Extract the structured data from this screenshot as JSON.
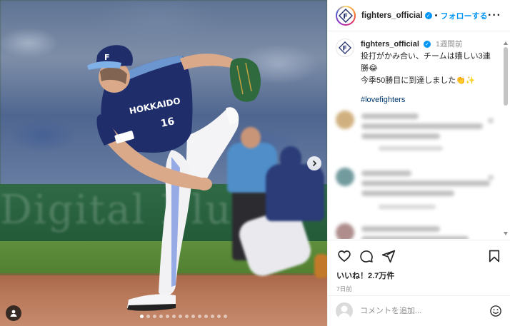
{
  "photo": {
    "alt": "",
    "banner_text": "Digital Blue",
    "jersey": {
      "team": "HOKKAIDO",
      "number": "16",
      "cap_letter": "F"
    },
    "pager": {
      "count": 14,
      "active_index": 0
    }
  },
  "header": {
    "username": "fighters_official",
    "separator": "•",
    "follow_label": "フォローする",
    "more_label": "···"
  },
  "caption": {
    "username": "fighters_official",
    "time": "1週間前",
    "lines": [
      "投打がかみ合い、チームは嬉しい3連",
      "勝😂",
      "今季50勝目に到達しました👏✨"
    ],
    "hashtag": "#lovefighters"
  },
  "actions": {
    "likes": "いいね！2.7万件",
    "date": "7日前"
  },
  "add_comment": {
    "placeholder": "コメントを追加..."
  },
  "colors": {
    "accent": "#0095f6",
    "jersey": "#1f2d6b",
    "verified": "#0095f6"
  }
}
